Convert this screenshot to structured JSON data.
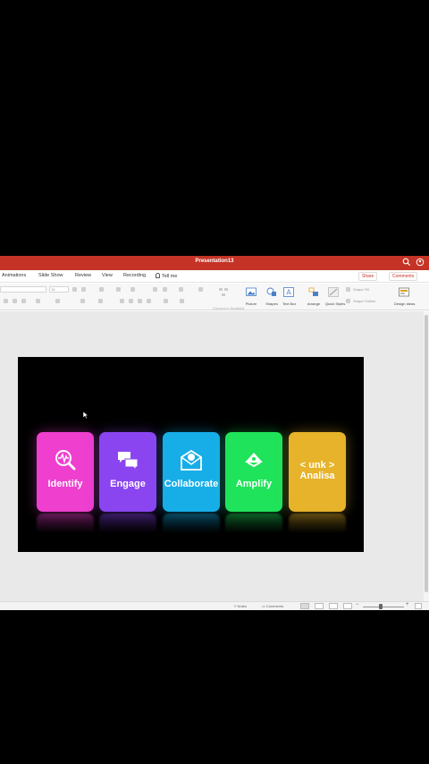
{
  "window": {
    "title": "Presentation13"
  },
  "tabs": [
    {
      "label": "Animations"
    },
    {
      "label": "Slide Show"
    },
    {
      "label": "Review"
    },
    {
      "label": "View"
    },
    {
      "label": "Recording"
    }
  ],
  "tell_me": "Tell me",
  "share_label": "Share",
  "comments_label": "Comments",
  "ribbon": {
    "font_size_value": "18",
    "convert_label": "Convert to SmartArt",
    "picture_label": "Picture",
    "shapes_label": "Shapes",
    "textbox_label": "Text Box",
    "arrange_label": "Arrange",
    "quick_styles_label": "Quick Styles",
    "shape_fill_label": "Shape Fill",
    "shape_outline_label": "Shape Outline",
    "design_ideas_label": "Design Ideas"
  },
  "slide": {
    "cards": [
      {
        "label": "Identify",
        "color": "#ee3fcf",
        "icon": "search-pulse-icon"
      },
      {
        "label": "Engage",
        "color": "#8a45f0",
        "icon": "chat-bubbles-icon"
      },
      {
        "label": "Collaborate",
        "color": "#17aee8",
        "icon": "mail-globe-icon"
      },
      {
        "label": "Amplify",
        "color": "#1fe35a",
        "icon": "megaphone-icon"
      },
      {
        "label": "< unk >\nAnalisa",
        "color": "#e6b32a",
        "icon": ""
      }
    ]
  },
  "statusbar": {
    "notes_label": "Notes",
    "comments_label": "Comments"
  }
}
